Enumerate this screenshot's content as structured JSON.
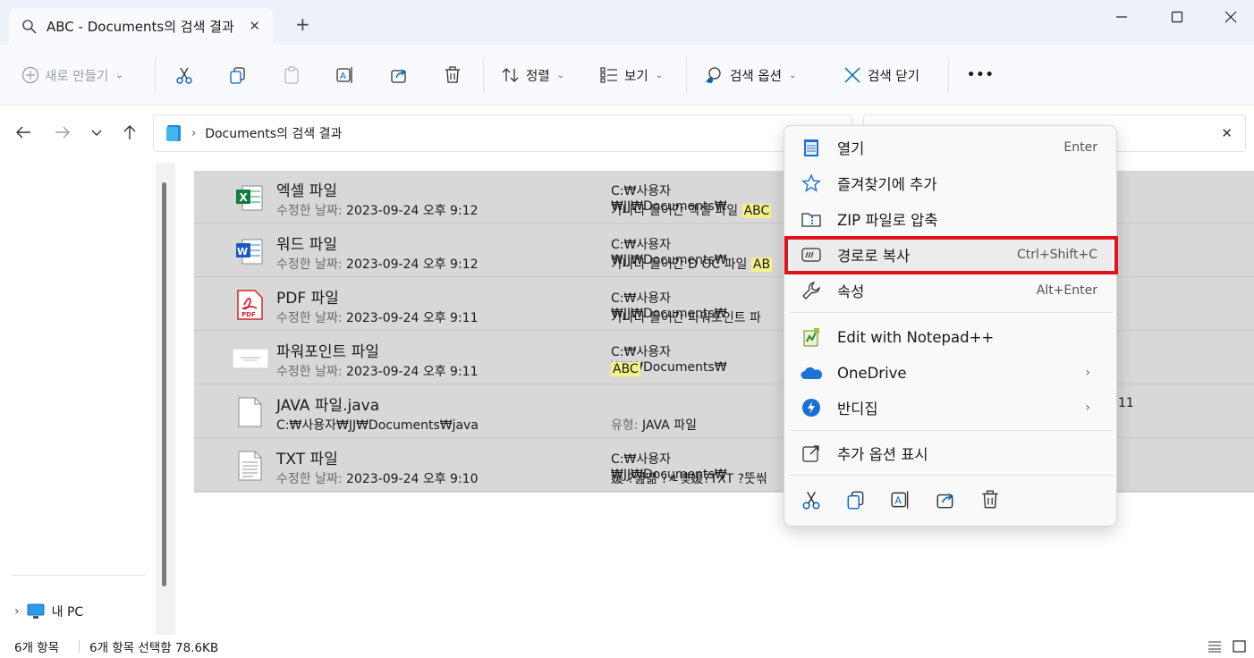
{
  "tab": {
    "title": "ABC - Documents의 검색 결과",
    "close": "✕",
    "new": "+"
  },
  "window": {
    "minimize": "—",
    "close": "✕"
  },
  "toolbar": {
    "new_label": "새로 만들기",
    "sort_label": "정렬",
    "view_label": "보기",
    "search_options_label": "검색 옵션",
    "close_search_label": "검색 닫기",
    "more": "•••"
  },
  "address": {
    "path": "Documents의 검색 결과"
  },
  "search": {
    "clear": "✕"
  },
  "sidebar": {
    "my_pc": "내 PC"
  },
  "files": [
    {
      "name": "엑셀 파일",
      "date_label": "수정한 날짜:",
      "date": "2023-09-24 오후 9:12",
      "path": "C:₩사용자₩JJ₩Documents₩",
      "snippet": "가나다 들어간 엑셀 파일 ",
      "hl": "ABC",
      "icon": "excel-icon"
    },
    {
      "name": "워드 파일",
      "date_label": "수정한 날짜:",
      "date": "2023-09-24 오후 9:12",
      "path": "C:₩사용자₩JJ₩Documents₩",
      "snippet": "가나다 들어간 D OC 파일 ",
      "hl": "AB",
      "icon": "word-icon"
    },
    {
      "name": "PDF 파일",
      "date_label": "수정한 날짜:",
      "date": "2023-09-24 오후 9:11",
      "path": "C:₩사용자₩JJ₩Documents₩",
      "snippet": "가나다 들어간 파워포인트 파",
      "hl": "",
      "icon": "pdf-icon"
    },
    {
      "name": "파워포인트 파일",
      "date_label": "수정한 날짜:",
      "date": "2023-09-24 오후 9:11",
      "path": "C:₩사용자₩JJ₩Documents₩",
      "snippet": "",
      "hl": "ABC",
      "icon": "ppt-thumbnail-icon"
    },
    {
      "name": "JAVA 파일.java",
      "path_line": "C:₩사용자₩JJ₩Documents₩java",
      "type_label": "유형:",
      "type": "JAVA 파일",
      "extra": "11",
      "icon": "java-file-icon"
    },
    {
      "name": "TXT 파일",
      "date_label": "수정한 날짜:",
      "date": "2023-09-24 오후 9:10",
      "path": "C:₩사용자₩JJ₩Documents₩",
      "snippet": "媛 ?섎떎 ?ㅻ뱾媛?TXT ?뚯씪",
      "hl": "",
      "icon": "txt-icon"
    }
  ],
  "status": {
    "count": "6개 항목",
    "selected": "6개 항목 선택함 78.6KB"
  },
  "context_menu": {
    "open": {
      "label": "열기",
      "shortcut": "Enter"
    },
    "favorite": {
      "label": "즐겨찾기에 추가"
    },
    "zip": {
      "label": "ZIP 파일로 압축"
    },
    "copy_path": {
      "label": "경로로 복사",
      "shortcut": "Ctrl+Shift+C"
    },
    "properties": {
      "label": "속성",
      "shortcut": "Alt+Enter"
    },
    "notepad": {
      "label": "Edit with Notepad++"
    },
    "onedrive": {
      "label": "OneDrive"
    },
    "bandizip": {
      "label": "반디집"
    },
    "more_options": {
      "label": "추가 옵션 표시"
    }
  },
  "colors": {
    "highlight_box": "#e0141e",
    "accent": "#0067c0",
    "search_highlight": "#f4f08a"
  }
}
